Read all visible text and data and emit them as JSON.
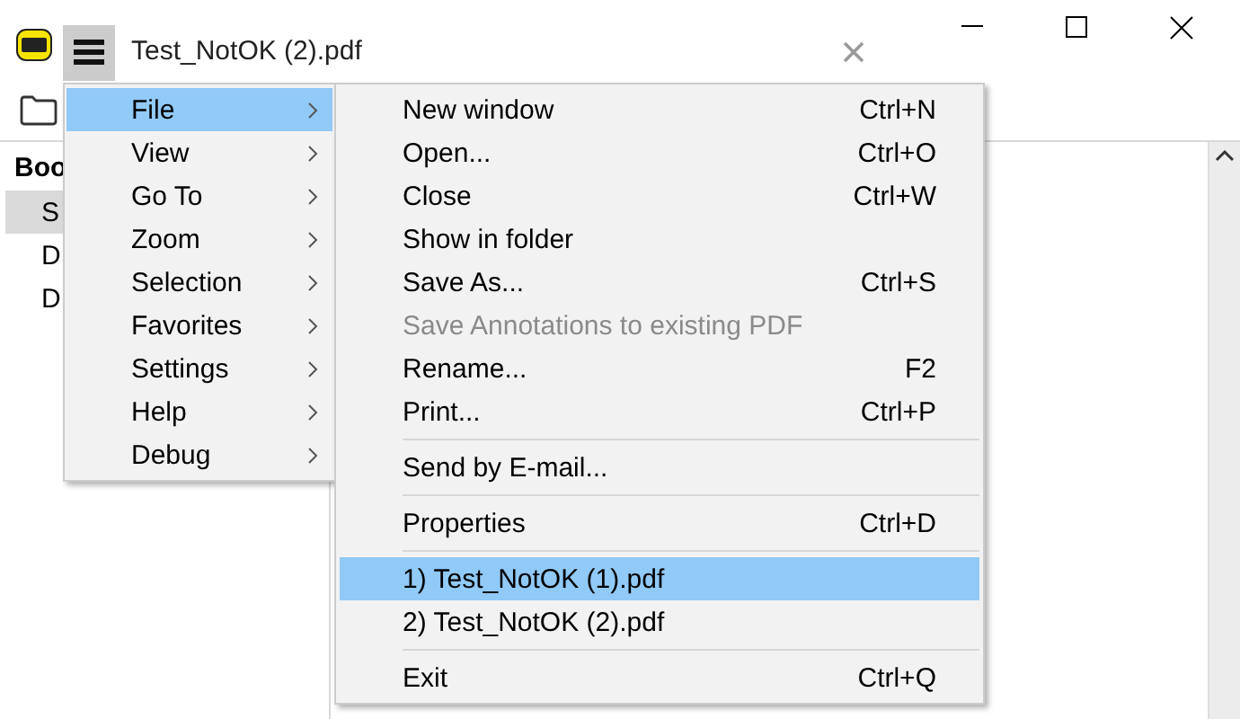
{
  "window": {
    "tab_title": "Test_NotOK (2).pdf"
  },
  "bookmarks": {
    "header": "Boo",
    "items": [
      {
        "label": "S",
        "selected": true
      },
      {
        "label": "D",
        "selected": false
      },
      {
        "label": "D",
        "selected": false
      }
    ]
  },
  "menu": {
    "items": [
      {
        "label": "File",
        "selected": true
      },
      {
        "label": "View",
        "selected": false
      },
      {
        "label": "Go To",
        "selected": false
      },
      {
        "label": "Zoom",
        "selected": false
      },
      {
        "label": "Selection",
        "selected": false
      },
      {
        "label": "Favorites",
        "selected": false
      },
      {
        "label": "Settings",
        "selected": false
      },
      {
        "label": "Help",
        "selected": false
      },
      {
        "label": "Debug",
        "selected": false
      }
    ]
  },
  "submenu": {
    "items": [
      {
        "kind": "item",
        "label": "New window",
        "shortcut": "Ctrl+N",
        "disabled": false,
        "selected": false
      },
      {
        "kind": "item",
        "label": "Open...",
        "shortcut": "Ctrl+O",
        "disabled": false,
        "selected": false
      },
      {
        "kind": "item",
        "label": "Close",
        "shortcut": "Ctrl+W",
        "disabled": false,
        "selected": false
      },
      {
        "kind": "item",
        "label": "Show in folder",
        "disabled": false,
        "selected": false
      },
      {
        "kind": "item",
        "label": "Save As...",
        "shortcut": "Ctrl+S",
        "disabled": false,
        "selected": false
      },
      {
        "kind": "item",
        "label": "Save Annotations to existing PDF",
        "disabled": true,
        "selected": false
      },
      {
        "kind": "item",
        "label": "Rename...",
        "shortcut": "F2",
        "disabled": false,
        "selected": false
      },
      {
        "kind": "item",
        "label": "Print...",
        "shortcut": "Ctrl+P",
        "disabled": false,
        "selected": false
      },
      {
        "kind": "separator"
      },
      {
        "kind": "item",
        "label": "Send by E-mail...",
        "disabled": false,
        "selected": false
      },
      {
        "kind": "separator"
      },
      {
        "kind": "item",
        "label": "Properties",
        "shortcut": "Ctrl+D",
        "disabled": false,
        "selected": false
      },
      {
        "kind": "separator"
      },
      {
        "kind": "item",
        "label": "1) Test_NotOK (1).pdf",
        "disabled": false,
        "selected": true
      },
      {
        "kind": "item",
        "label": "2) Test_NotOK (2).pdf",
        "disabled": false,
        "selected": false
      },
      {
        "kind": "separator"
      },
      {
        "kind": "item",
        "label": "Exit",
        "shortcut": "Ctrl+Q",
        "disabled": false,
        "selected": false
      }
    ]
  }
}
